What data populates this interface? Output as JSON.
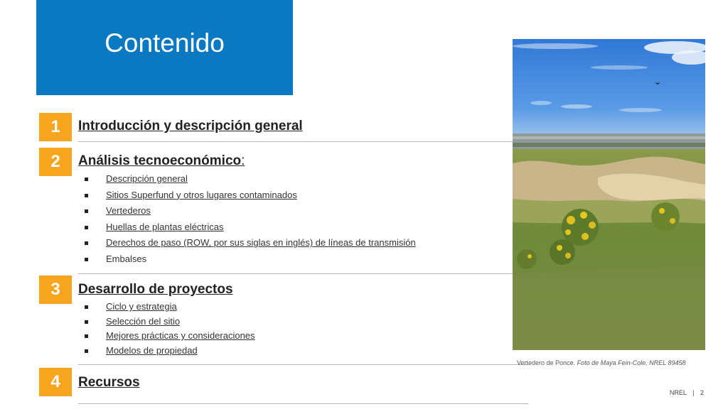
{
  "title": "Contenido",
  "sections": [
    {
      "number": "1",
      "title": "Introducción y descripción general"
    },
    {
      "number": "2",
      "title": "Análisis tecnoeconómico",
      "suffix": ":",
      "items": [
        "Descripción general",
        "Sitios Superfund y otros lugares contaminados",
        "Vertederos",
        "Huellas de plantas eléctricas",
        "Derechos de paso (ROW, por sus siglas en inglés) de líneas de transmisión",
        "Embalses"
      ]
    },
    {
      "number": "3",
      "title": "Desarrollo de proyectos",
      "items": [
        "Ciclo y estrategia",
        "Selección del sitio",
        "Mejores prácticas y consideraciones",
        "Modelos de propiedad"
      ]
    },
    {
      "number": "4",
      "title": "Recursos"
    }
  ],
  "photo": {
    "caption_plain": "Vertedero de Ponce. ",
    "caption_italic": "Foto de Maya Fein-Cole, NREL 89458"
  },
  "footer": {
    "org": "NREL",
    "separator": "|",
    "page": "2"
  },
  "colors": {
    "title_bg": "#0b79c2",
    "number_bg": "#f7a51e"
  }
}
